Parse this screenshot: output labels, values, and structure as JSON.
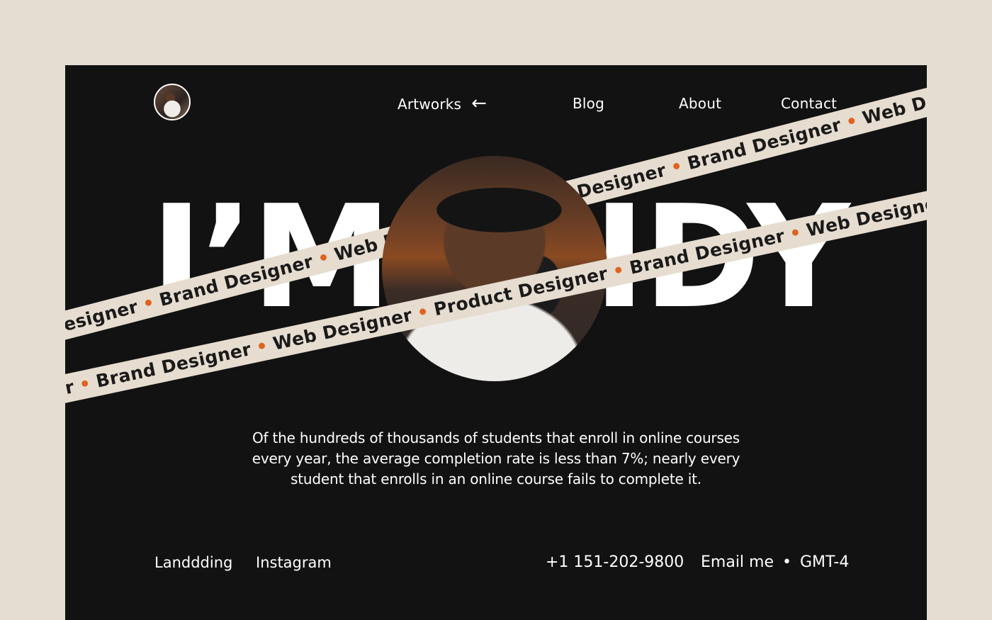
{
  "nav": {
    "artworks": "Artworks",
    "artworks_icon": "arrow-left-icon",
    "blog": "Blog",
    "about": "About",
    "contact": "Contact"
  },
  "hero": {
    "text_left": "I’M",
    "text_right": "IDY"
  },
  "ribbons": {
    "front": "signer • Brand Designer • Web Designer • Product Designer • Brand Designer • Web Designer • Product De",
    "back": "uct Designer • Brand Designer • Web Designer • Product Designer • Brand Designer • Web Designer • Produc",
    "dot_color": "#e0631d"
  },
  "description": "Of the hundreds of thousands of students that enroll in online courses every year, the average completion rate is less than 7%; nearly every student that enrolls in an online course fails to complete it.",
  "footer": {
    "link1": "Landdding",
    "link2": "Instagram",
    "phone": "+1 151-202-9800",
    "email": "Email me",
    "separator": "•",
    "timezone": "GMT-4"
  },
  "colors": {
    "page_bg": "#e4ddd2",
    "frame_bg": "#121212",
    "ribbon_bg": "#e6ddd0",
    "accent": "#e0631d"
  }
}
